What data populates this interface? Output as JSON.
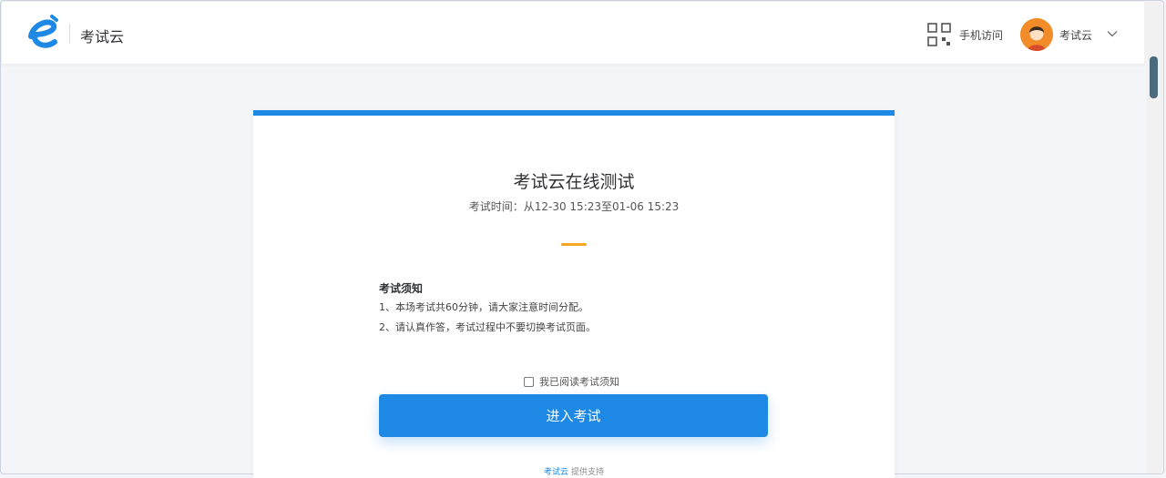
{
  "header": {
    "brand": "考试云",
    "mobile_access": "手机访问",
    "user_name": "考试云"
  },
  "exam": {
    "title": "考试云在线测试",
    "time_label": "考试时间：",
    "time_range": "从12-30 15:23至01-06 15:23",
    "notice_title": "考试须知",
    "notices": [
      "1、本场考试共60分钟，请大家注意时间分配。",
      "2、请认真作答，考试过程中不要切换考试页面。"
    ],
    "agree_label": "我已阅读考试须知",
    "agree_checked": false,
    "enter_button": "进入考试",
    "footer_brand": "考试云",
    "footer_text": "提供支持"
  },
  "colors": {
    "primary": "#1e88e5",
    "accent": "#f5a623",
    "avatar": "#f28c28"
  },
  "icons": [
    "logo-e-icon",
    "qr-code-icon",
    "avatar-icon",
    "chevron-down-icon"
  ]
}
